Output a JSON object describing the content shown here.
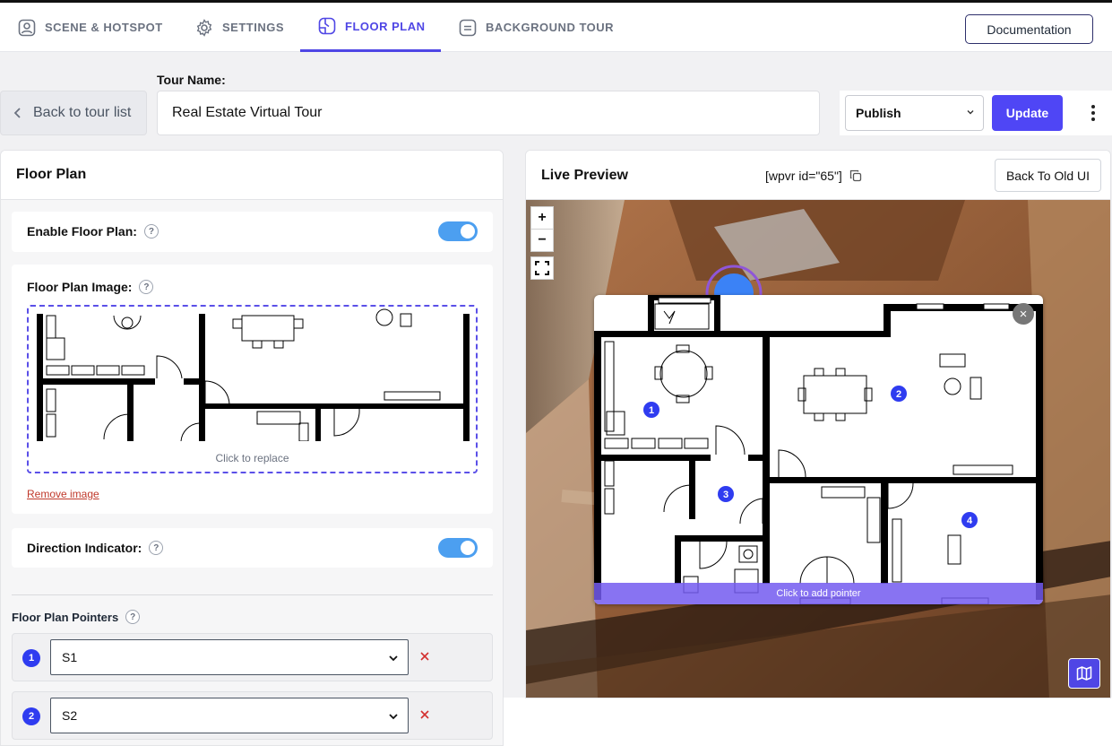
{
  "tabs": [
    {
      "label": "SCENE & HOTSPOT",
      "icon": "scene-hotspot-icon"
    },
    {
      "label": "SETTINGS",
      "icon": "gear-icon"
    },
    {
      "label": "FLOOR PLAN",
      "icon": "floor-plan-icon",
      "active": true
    },
    {
      "label": "BACKGROUND TOUR",
      "icon": "background-tour-icon"
    }
  ],
  "header": {
    "documentation_label": "Documentation"
  },
  "toolbar": {
    "back_label": "Back to tour list",
    "tour_name_label": "Tour Name:",
    "tour_name_value": "Real Estate Virtual Tour",
    "status_value": "Publish",
    "update_label": "Update"
  },
  "floor_plan_panel": {
    "title": "Floor Plan",
    "enable_label": "Enable Floor Plan:",
    "enable_on": true,
    "image_label": "Floor Plan Image:",
    "replace_text": "Click to replace",
    "remove_label": "Remove image",
    "direction_label": "Direction Indicator:",
    "direction_on": true,
    "pointers_label": "Floor Plan Pointers",
    "help_glyph": "?",
    "pointers": [
      {
        "number": "1",
        "scene": "S1"
      },
      {
        "number": "2",
        "scene": "S2"
      }
    ]
  },
  "preview": {
    "title": "Live Preview",
    "shortcode": "[wpvr id=\"65\"]",
    "old_ui_label": "Back To Old UI",
    "zoom_in": "+",
    "zoom_out": "−",
    "close_glyph": "×",
    "add_pointer_text": "Click to add pointer",
    "markers": [
      "1",
      "2",
      "3",
      "4"
    ]
  },
  "colors": {
    "accent": "#4f46e5",
    "toggle": "#4c9ff0",
    "marker": "#2f3cf0",
    "danger": "#d32f2f"
  }
}
